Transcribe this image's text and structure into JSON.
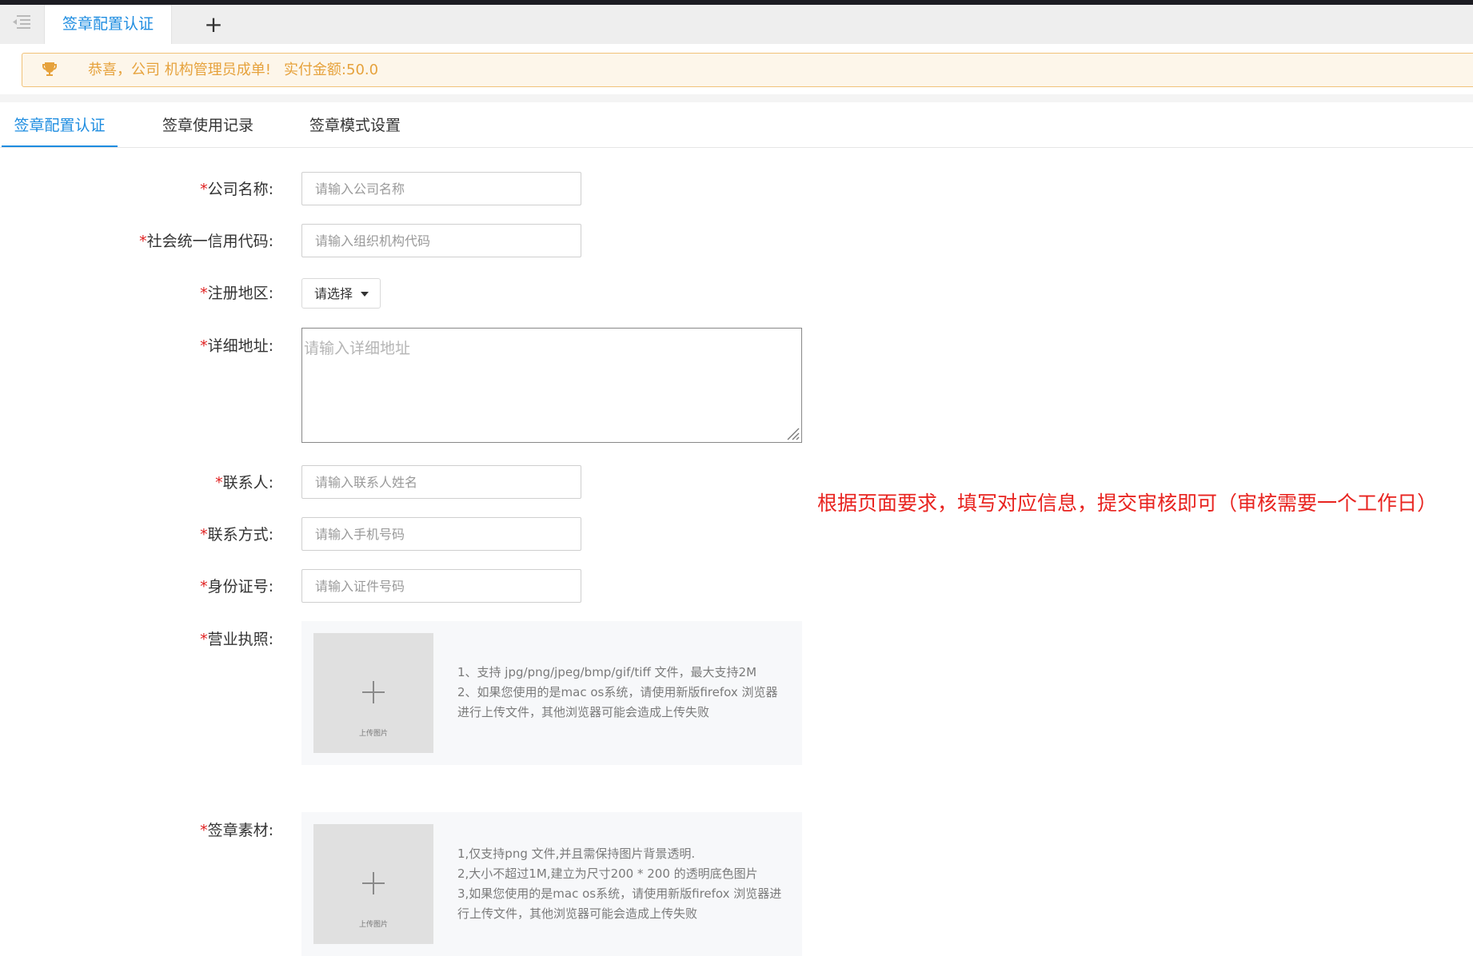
{
  "tabs": {
    "active_label": "签章配置认证",
    "add_label": "+"
  },
  "notice": {
    "congrats": "恭喜，公司 机构管理员成单!",
    "amount": "实付金额:50.0",
    "color": "#e6a23c"
  },
  "subtabs": [
    {
      "label": "签章配置认证",
      "active": true
    },
    {
      "label": "签章使用记录",
      "active": false
    },
    {
      "label": "签章模式设置",
      "active": false
    }
  ],
  "form": {
    "required_mark": "*",
    "company_name": {
      "label": "公司名称:",
      "placeholder": "请输入公司名称"
    },
    "credit_code": {
      "label": "社会统一信用代码:",
      "placeholder": "请输入组织机构代码"
    },
    "region": {
      "label": "注册地区:",
      "value": "请选择"
    },
    "address": {
      "label": "详细地址:",
      "placeholder": "请输入详细地址"
    },
    "contact": {
      "label": "联系人:",
      "placeholder": "请输入联系人姓名"
    },
    "phone": {
      "label": "联系方式:",
      "placeholder": "请输入手机号码"
    },
    "id_number": {
      "label": "身份证号:",
      "placeholder": "请输入证件号码"
    },
    "license": {
      "label": "营业执照:",
      "upload_caption": "上传图片",
      "hints": [
        "1、支持 jpg/png/jpeg/bmp/gif/tiff 文件，最大支持2M",
        "2、如果您使用的是mac os系统，请使用新版firefox 浏览器",
        "进行上传文件，其他浏览器可能会造成上传失败"
      ]
    },
    "seal": {
      "label": "签章素材:",
      "upload_caption": "上传图片",
      "hints": [
        "1,仅支持png 文件,并且需保持图片背景透明.",
        "2,大小不超过1M,建立为尺寸200 * 200 的透明底色图片",
        "3,如果您使用的是mac os系统，请使用新版firefox 浏览器进",
        "行上传文件，其他浏览器可能会造成上传失败"
      ]
    }
  },
  "annotation": "根据页面要求，填写对应信息，提交审核即可（审核需要一个工作日）",
  "colors": {
    "accent": "#1d8ce0",
    "required": "#e02020",
    "annotation": "#e8231f"
  }
}
